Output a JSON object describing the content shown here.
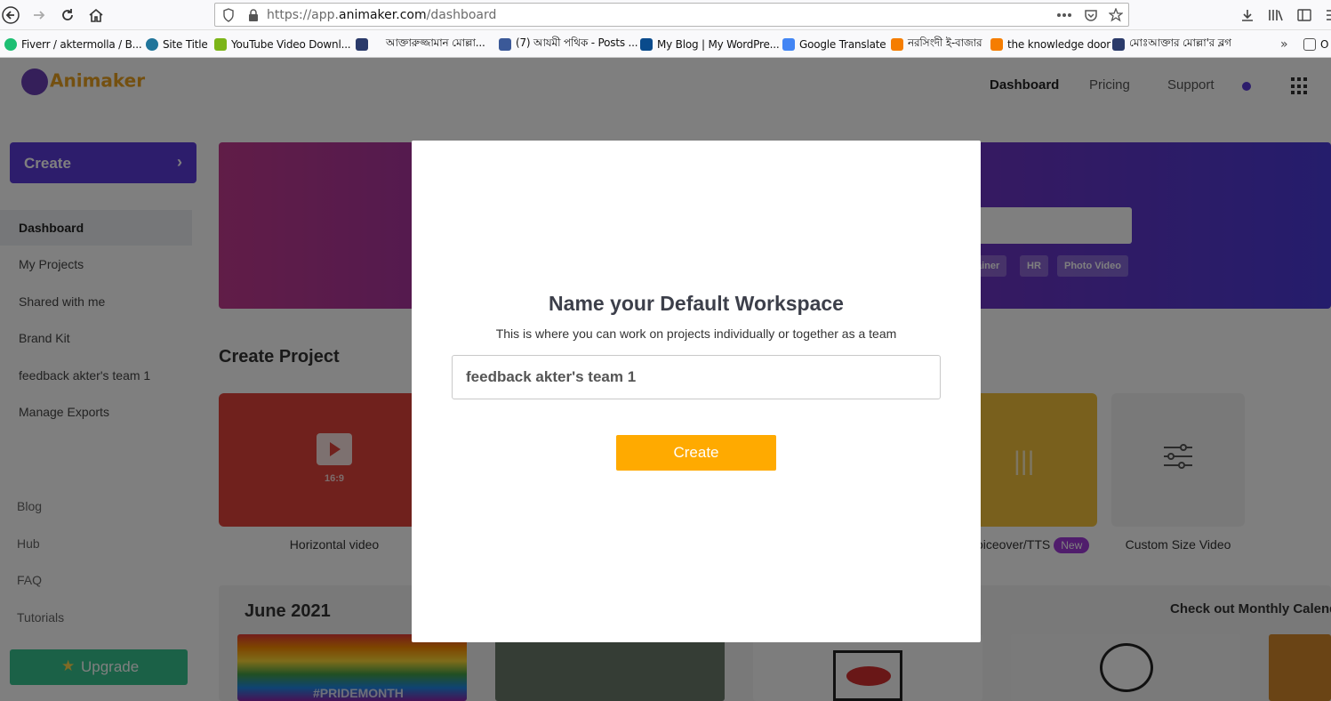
{
  "browser": {
    "url_prefix": "https://app.",
    "url_domain": "animaker.com",
    "url_path": "/dashboard",
    "bookmarks": [
      {
        "label": "Fiverr / aktermolla / B...",
        "color": "#1dbf73"
      },
      {
        "label": "Site Title",
        "color": "#21759b"
      },
      {
        "label": "YouTube Video Downl...",
        "color": "#7cb518"
      },
      {
        "label": "",
        "color": "#2a3a6a"
      },
      {
        "label": "আক্তারুজ্জামান মোল্লা...",
        "color": ""
      },
      {
        "label": "(7) আযমী পথিক - Posts ...",
        "color": "#3b5998"
      },
      {
        "label": "My Blog | My WordPre...",
        "color": "#0a4b8c"
      },
      {
        "label": "Google Translate",
        "color": "#4285f4"
      },
      {
        "label": "নরসিংদী ই-বাজার",
        "color": "#f57d00"
      },
      {
        "label": "the knowledge door",
        "color": "#f57d00"
      },
      {
        "label": "মোঃআক্তার মোল্লা'র ব্লগ",
        "color": "#2a3a6a"
      },
      {
        "label": "O",
        "color": ""
      }
    ]
  },
  "header": {
    "logo": "Animaker",
    "nav": [
      "Dashboard",
      "Pricing",
      "Support"
    ]
  },
  "sidebar": {
    "create_label": "Create",
    "items": [
      "Dashboard",
      "My Projects",
      "Shared with me",
      "Brand Kit",
      "feedback akter's team 1",
      "Manage Exports"
    ],
    "minor": [
      "Blog",
      "Hub",
      "FAQ",
      "Tutorials"
    ],
    "upgrade_label": "Upgrade"
  },
  "hero": {
    "chips": [
      "ainer",
      "HR",
      "Photo Video"
    ]
  },
  "main": {
    "section_title": "Create Project",
    "cards": [
      {
        "label": "Horizontal video",
        "sub": "16:9",
        "color": "#e0433b"
      },
      {
        "label": "oiceover/TTS",
        "badge": "New",
        "color": "#f3c13a"
      },
      {
        "label": "Custom Size Video",
        "color": "#f2f2f2"
      }
    ],
    "month_title": "June 2021",
    "month_link": "Check out Monthly Calenda",
    "thumb_text": "#PRIDEMONTH"
  },
  "modal": {
    "title": "Name your Default Workspace",
    "subtitle": "This is where you can work on projects individually or together as a team",
    "input_value": "feedback akter's team 1",
    "button_label": "Create"
  }
}
